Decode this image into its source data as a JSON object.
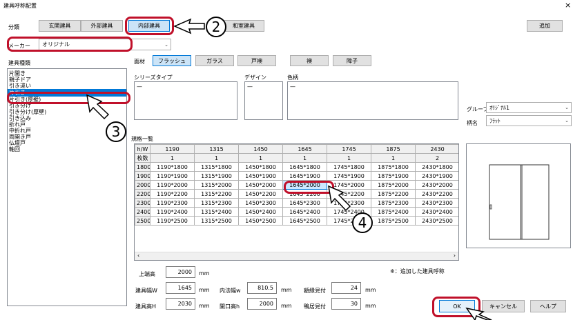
{
  "window": {
    "title": "建具呼称配置",
    "close": "×"
  },
  "category": {
    "label": "分類",
    "tabs": [
      "玄関建具",
      "外部建具",
      "内部建具",
      "和室建具"
    ],
    "add_label": "追加"
  },
  "maker": {
    "label": "メーカー",
    "value": "オリジナル"
  },
  "kinds": {
    "label": "建具種類",
    "items": [
      "片開き",
      "親子ドア",
      "引き違い",
      "片引き",
      "片引き(厚壁)",
      "引き分け",
      "引き分け(厚壁)",
      "引き込み",
      "折れ戸",
      "中折れ戸",
      "両開き戸",
      "仏壇戸",
      "軸回"
    ],
    "selected_index": 3
  },
  "material": {
    "label": "面材",
    "options": [
      "フラッシュ",
      "ガラス",
      "戸襖",
      "襖",
      "障子"
    ],
    "selected_index": 0
  },
  "series": {
    "label": "シリーズタイプ",
    "value": "—"
  },
  "design": {
    "label": "デザイン",
    "value": "—"
  },
  "color": {
    "label": "色柄",
    "value": "—"
  },
  "group": {
    "label": "グループ",
    "value": "ｵﾘｼﾞﾅﾙ1"
  },
  "pattern": {
    "label": "柄名",
    "value": "ﾌﾗｯﾄ"
  },
  "spec_table": {
    "label": "規格一覧",
    "corner": "h/W",
    "columns": [
      "1190",
      "1315",
      "1450",
      "1645",
      "1745",
      "1875",
      "2430"
    ],
    "count_label": "枚数",
    "counts": [
      "1",
      "1",
      "1",
      "1",
      "1",
      "1",
      "2"
    ],
    "rows": [
      {
        "h": "1800",
        "cells": [
          "1190*1800",
          "1315*1800",
          "1450*1800",
          "1645*1800",
          "1745*1800",
          "1875*1800",
          "2430*1800"
        ]
      },
      {
        "h": "1900",
        "cells": [
          "1190*1900",
          "1315*1900",
          "1450*1900",
          "1645*1900",
          "1745*1900",
          "1875*1900",
          "2430*1900"
        ]
      },
      {
        "h": "2000",
        "cells": [
          "1190*2000",
          "1315*2000",
          "1450*2000",
          "1645*2000",
          "1745*2000",
          "1875*2000",
          "2430*2000"
        ]
      },
      {
        "h": "2200",
        "cells": [
          "1190*2200",
          "1315*2200",
          "1450*2200",
          "1645*2200",
          "1745*2200",
          "1875*2200",
          "2430*2200"
        ]
      },
      {
        "h": "2300",
        "cells": [
          "1190*2300",
          "1315*2300",
          "1450*2300",
          "1645*2300",
          "1745*2300",
          "1875*2300",
          "2430*2300"
        ]
      },
      {
        "h": "2400",
        "cells": [
          "1190*2400",
          "1315*2400",
          "1450*2400",
          "1645*2400",
          "1745*2400",
          "1875*2400",
          "2430*2400"
        ]
      },
      {
        "h": "2500",
        "cells": [
          "1190*2500",
          "1315*2500",
          "1450*2500",
          "1645*2500",
          "1745*2500",
          "1875*2500",
          "2430*2500"
        ]
      }
    ],
    "selected_row": 2,
    "selected_col": 3
  },
  "note": "※：追加した建具呼称",
  "fields": {
    "top_height": {
      "label": "上端高",
      "value": "2000",
      "unit": "mm"
    },
    "width": {
      "label": "建具幅W",
      "value": "1645",
      "unit": "mm"
    },
    "inner_width": {
      "label": "内法幅w",
      "value": "810.5",
      "unit": "mm"
    },
    "frame_width": {
      "label": "額縁見付",
      "value": "24",
      "unit": "mm"
    },
    "height": {
      "label": "建具高H",
      "value": "2030",
      "unit": "mm"
    },
    "opening_height": {
      "label": "開口高h",
      "value": "2000",
      "unit": "mm"
    },
    "sill_width": {
      "label": "鴨居見付",
      "value": "30",
      "unit": "mm"
    }
  },
  "buttons": {
    "ok": "OK",
    "cancel": "キャンセル",
    "help": "ヘルプ"
  },
  "callouts": [
    "2",
    "3",
    "4"
  ],
  "colors": {
    "highlight": "#c0102a",
    "selection": "#0078d7",
    "cell_selection": "#cce8ff"
  }
}
